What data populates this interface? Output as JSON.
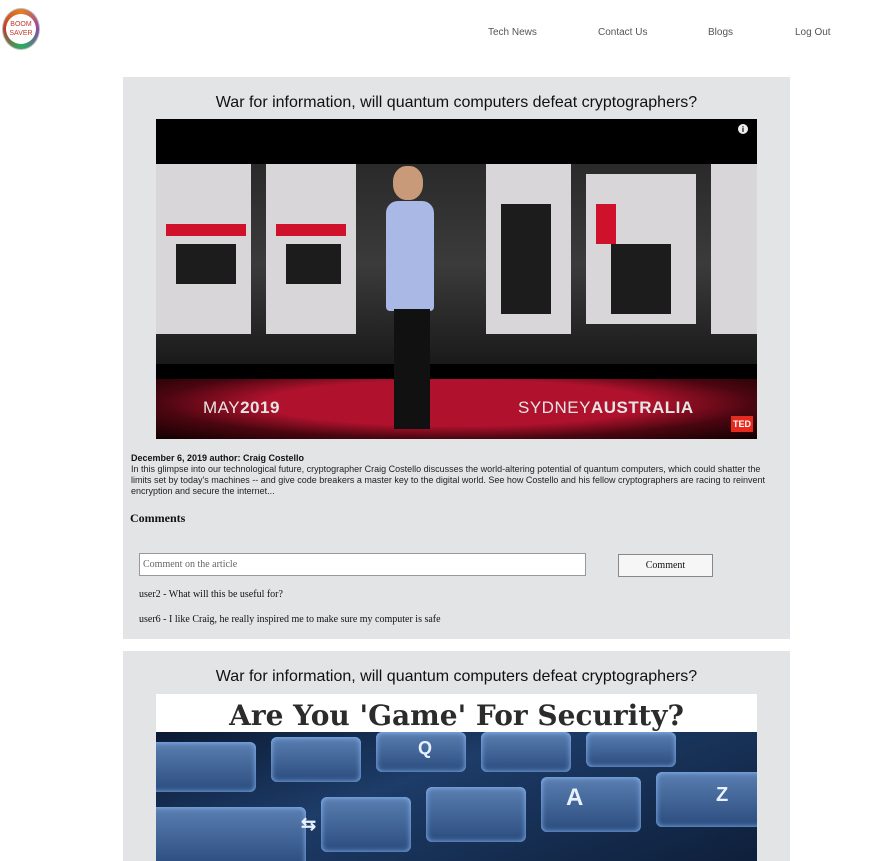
{
  "header": {
    "logo": {
      "line1": "BOOM",
      "line2": "SAVER"
    },
    "nav": [
      {
        "label": "Tech News"
      },
      {
        "label": "Contact Us"
      },
      {
        "label": "Blogs"
      },
      {
        "label": "Log Out"
      }
    ]
  },
  "articles": [
    {
      "title": "War for information, will quantum computers defeat cryptographers?",
      "video": {
        "date_text": "MAY2019",
        "location_text": "SYDNEYAUSTRALIA",
        "date_a": "MAY",
        "date_b": "2019",
        "loc_a": "SYDNEY",
        "loc_b": "AUSTRALIA",
        "badge": "TED"
      },
      "meta": "December 6, 2019 author: Craig Costello",
      "description": "In this glimpse into our technological future, cryptographer Craig Costello discusses the world-altering potential of quantum computers, which could shatter the limits set by today's machines -- and give code breakers a master key to the digital world. See how Costello and his fellow cryptographers are racing to reinvent encryption and secure the internet...",
      "comments_heading": "Comments",
      "comment_placeholder": "Comment on the article",
      "comment_button": "Comment",
      "comments": [
        {
          "text": "user2 - What will this be useful for?"
        },
        {
          "text": "user6 - I like Craig, he really inspired me to make sure my computer is safe"
        }
      ]
    },
    {
      "title": "War for information, will quantum computers defeat cryptographers?",
      "image_caption": "Are You 'Game' For Security?"
    }
  ]
}
